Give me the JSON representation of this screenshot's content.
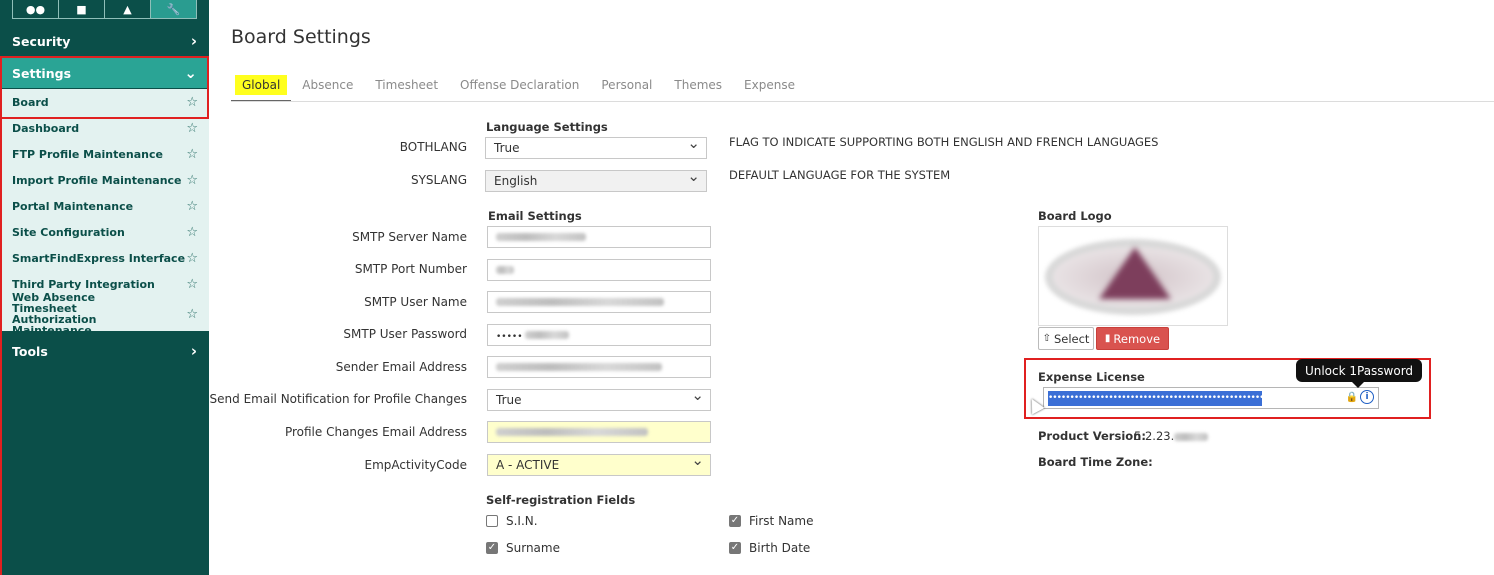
{
  "sidebar": {
    "tab_icons": [
      "people-icon",
      "briefcase-icon",
      "person-icon",
      "wrench-icon"
    ],
    "security_label": "Security",
    "settings_label": "Settings",
    "tools_label": "Tools",
    "items": [
      {
        "label": "Board"
      },
      {
        "label": "Dashboard"
      },
      {
        "label": "FTP Profile Maintenance"
      },
      {
        "label": "Import Profile Maintenance"
      },
      {
        "label": "Portal Maintenance"
      },
      {
        "label": "Site Configuration"
      },
      {
        "label": "SmartFindExpress Interface"
      },
      {
        "label": "Third Party Integration"
      },
      {
        "label": "Web Absence Timesheet Authorization Maintenance"
      }
    ]
  },
  "page": {
    "title": "Board Settings",
    "tabs": [
      "Global",
      "Absence",
      "Timesheet",
      "Offense Declaration",
      "Personal",
      "Themes",
      "Expense"
    ],
    "active_tab": "Global"
  },
  "language": {
    "heading": "Language Settings",
    "bothlang_label": "BOTHLANG",
    "bothlang_value": "True",
    "bothlang_desc": "FLAG TO INDICATE SUPPORTING BOTH ENGLISH AND FRENCH LANGUAGES",
    "syslang_label": "SYSLANG",
    "syslang_value": "English",
    "syslang_desc": "DEFAULT LANGUAGE FOR THE SYSTEM"
  },
  "email": {
    "heading": "Email Settings",
    "smtp_server_label": "SMTP Server Name",
    "smtp_port_label": "SMTP Port Number",
    "smtp_user_label": "SMTP User Name",
    "smtp_password_label": "SMTP User Password",
    "smtp_password_value": "•••••",
    "sender_label": "Sender Email Address",
    "notify_label": "Send Email Notification for Profile Changes",
    "notify_value": "True",
    "profile_email_label": "Profile Changes Email Address",
    "emp_activity_label": "EmpActivityCode",
    "emp_activity_value": "A - ACTIVE"
  },
  "self_registration": {
    "heading": "Self-registration Fields",
    "fields": [
      {
        "label": "S.I.N.",
        "checked": false
      },
      {
        "label": "First Name",
        "checked": true
      },
      {
        "label": "Surname",
        "checked": true
      },
      {
        "label": "Birth Date",
        "checked": true
      }
    ]
  },
  "board": {
    "logo_heading": "Board Logo",
    "select_label": "Select",
    "remove_label": "Remove",
    "expense_license_label": "Expense License",
    "expense_license_value": "••••••••••••••••••••••••••••••••••••••••••••••••••••••••••",
    "tooltip": "Unlock 1Password",
    "product_version_label": "Product Version:",
    "product_version_value": "5.2.23.",
    "time_zone_label": "Board Time Zone:"
  },
  "colors": {
    "sidebar_bg": "#0b4f49",
    "sidebar_active": "#2aa495",
    "sidebar_item_bg": "#e3f2f0",
    "highlight_tab": "#ffff1e",
    "remove_button": "#d9534f",
    "annotation_red": "#e02020"
  }
}
